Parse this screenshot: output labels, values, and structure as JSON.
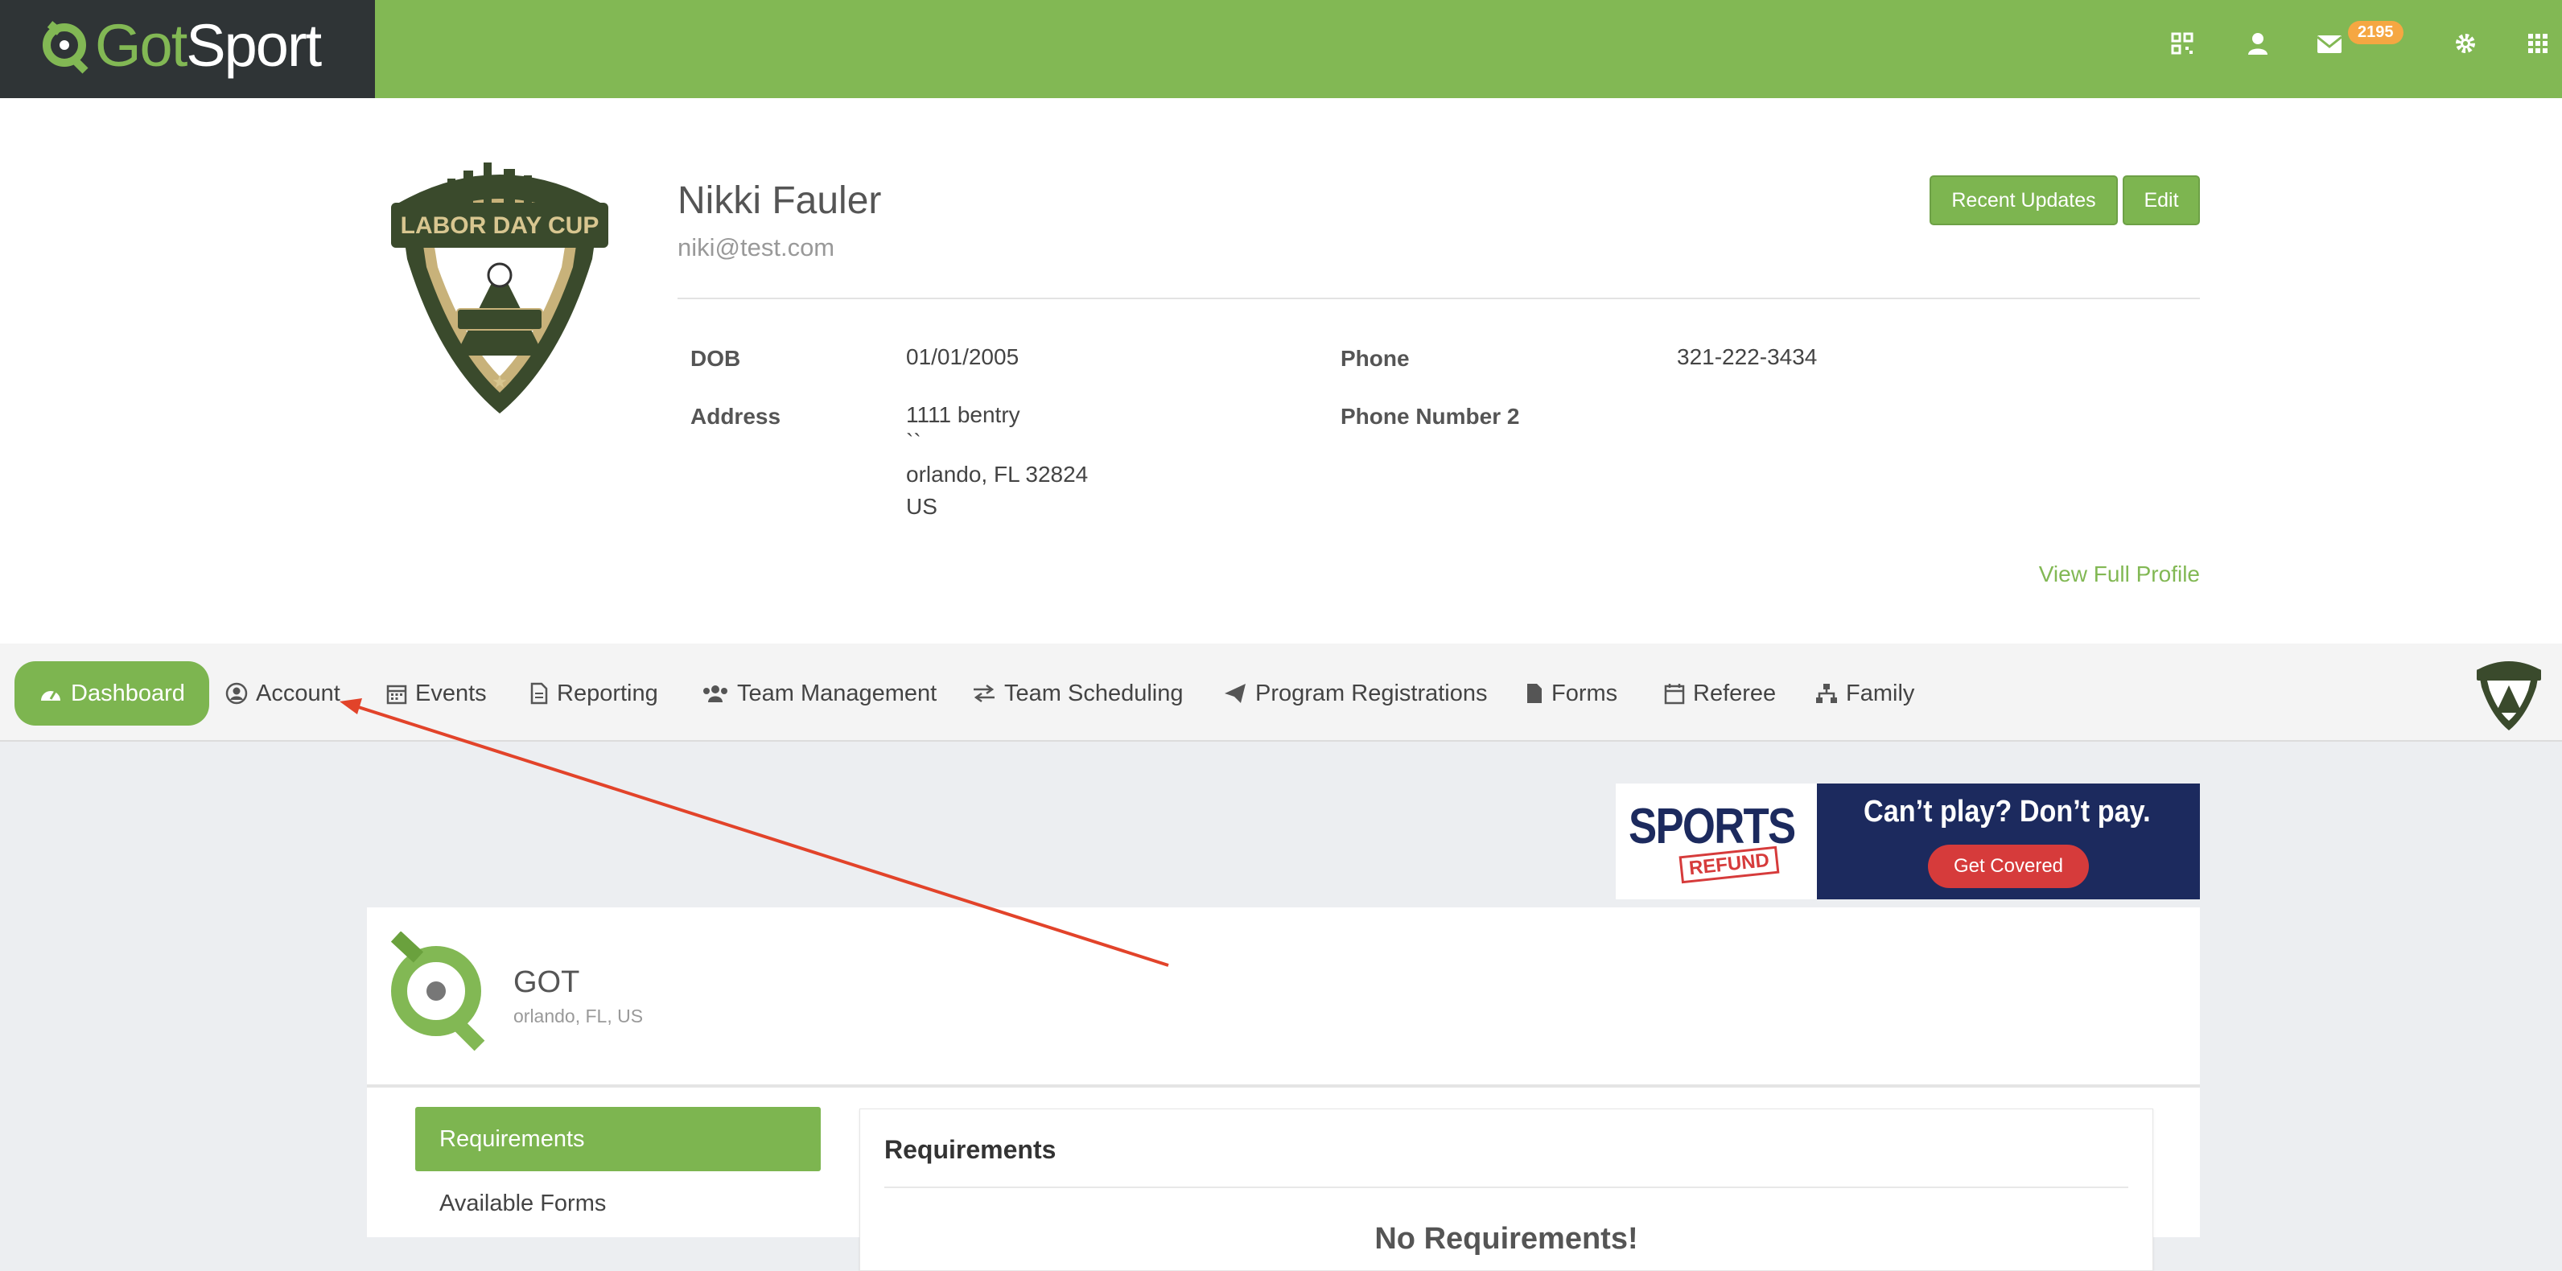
{
  "brand": {
    "name_prefix": "Got",
    "name_suffix": "Sport"
  },
  "topbar": {
    "icons": [
      "qr-code-icon",
      "user-icon",
      "envelope-icon",
      "gear-icon",
      "apps-grid-icon"
    ],
    "message_count": "2195"
  },
  "profile": {
    "name": "Nikki Fauler",
    "email": "niki@test.com",
    "recent_updates_label": "Recent Updates",
    "edit_label": "Edit",
    "dob_label": "DOB",
    "dob": "01/01/2005",
    "address_label": "Address",
    "address_line1": "1111 bentry",
    "address_line2": "``",
    "address_line3": "orlando, FL 32824",
    "address_line4": "US",
    "phone_label": "Phone",
    "phone": "321-222-3434",
    "phone2_label": "Phone Number 2",
    "view_full_profile": "View Full Profile",
    "crest_text": "LABOR DAY CUP"
  },
  "nav": {
    "items": [
      {
        "label": "Dashboard",
        "icon": "dashboard-icon"
      },
      {
        "label": "Account",
        "icon": "user-circle-icon"
      },
      {
        "label": "Events",
        "icon": "calendar-icon"
      },
      {
        "label": "Reporting",
        "icon": "document-icon"
      },
      {
        "label": "Team Management",
        "icon": "users-icon"
      },
      {
        "label": "Team Scheduling",
        "icon": "exchange-icon"
      },
      {
        "label": "Program Registrations",
        "icon": "paper-plane-icon"
      },
      {
        "label": "Forms",
        "icon": "file-icon"
      },
      {
        "label": "Referee",
        "icon": "calendar-o-icon"
      },
      {
        "label": "Family",
        "icon": "sitemap-icon"
      }
    ]
  },
  "ad": {
    "sports": "SPORTS",
    "refund": "REFUND",
    "tagline": "Can’t play? Don’t pay.",
    "button": "Get Covered"
  },
  "org": {
    "name": "GOT",
    "location": "orlando, FL, US",
    "tab_requirements": "Requirements",
    "tab_available_forms": "Available Forms",
    "panel_title": "Requirements",
    "no_requirements": "No Requirements!"
  },
  "colors": {
    "brand_green": "#82b854",
    "dark": "#2f3436",
    "annotation_red": "#e2432a"
  }
}
